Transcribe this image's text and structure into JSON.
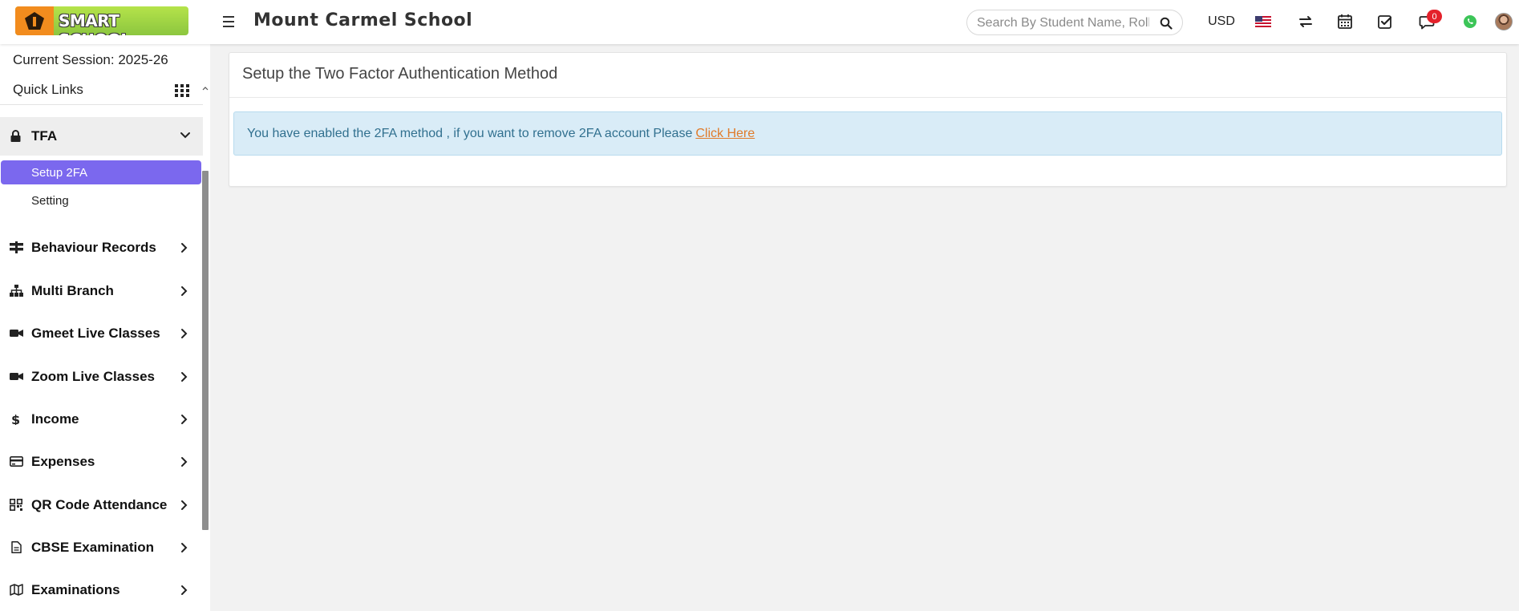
{
  "header": {
    "logo_text": "SMART SCHOOL",
    "school_name": "Mount Carmel School",
    "search_placeholder": "Search By Student Name, Roll Number, Enroll Number, National Id, Local Id Etc.",
    "currency": "USD",
    "chat_badge": "0",
    "icons": [
      "menu-icon",
      "search-icon",
      "us-flag-icon",
      "switch-icon",
      "calendar-icon",
      "task-check-icon",
      "chat-icon",
      "whatsapp-icon",
      "user-avatar"
    ]
  },
  "sidebar": {
    "session_label": "Current Session: 2025-26",
    "quick_links_label": "Quick Links",
    "active_group": {
      "label": "TFA",
      "icon": "lock-icon",
      "subitems": [
        {
          "label": "Setup 2FA",
          "active": true
        },
        {
          "label": "Setting",
          "active": false
        }
      ]
    },
    "items": [
      {
        "label": "Behaviour Records",
        "icon": "signpost-icon"
      },
      {
        "label": "Multi Branch",
        "icon": "sitemap-icon"
      },
      {
        "label": "Gmeet Live Classes",
        "icon": "video-icon"
      },
      {
        "label": "Zoom Live Classes",
        "icon": "video-icon"
      },
      {
        "label": "Income",
        "icon": "dollar-icon"
      },
      {
        "label": "Expenses",
        "icon": "credit-card-icon"
      },
      {
        "label": "QR Code Attendance",
        "icon": "qrcode-icon"
      },
      {
        "label": "CBSE Examination",
        "icon": "document-icon"
      },
      {
        "label": "Examinations",
        "icon": "map-icon"
      }
    ]
  },
  "main": {
    "title": "Setup the Two Factor Authentication Method",
    "alert_text": "You have enabled the 2FA method , if you want to remove 2FA account Please",
    "alert_link": "Click Here"
  },
  "colors": {
    "accent": "#7b68ee",
    "alert_bg": "#d9ecf7",
    "alert_text": "#31708f",
    "link": "#e07b2a",
    "badge": "#e4212b"
  }
}
